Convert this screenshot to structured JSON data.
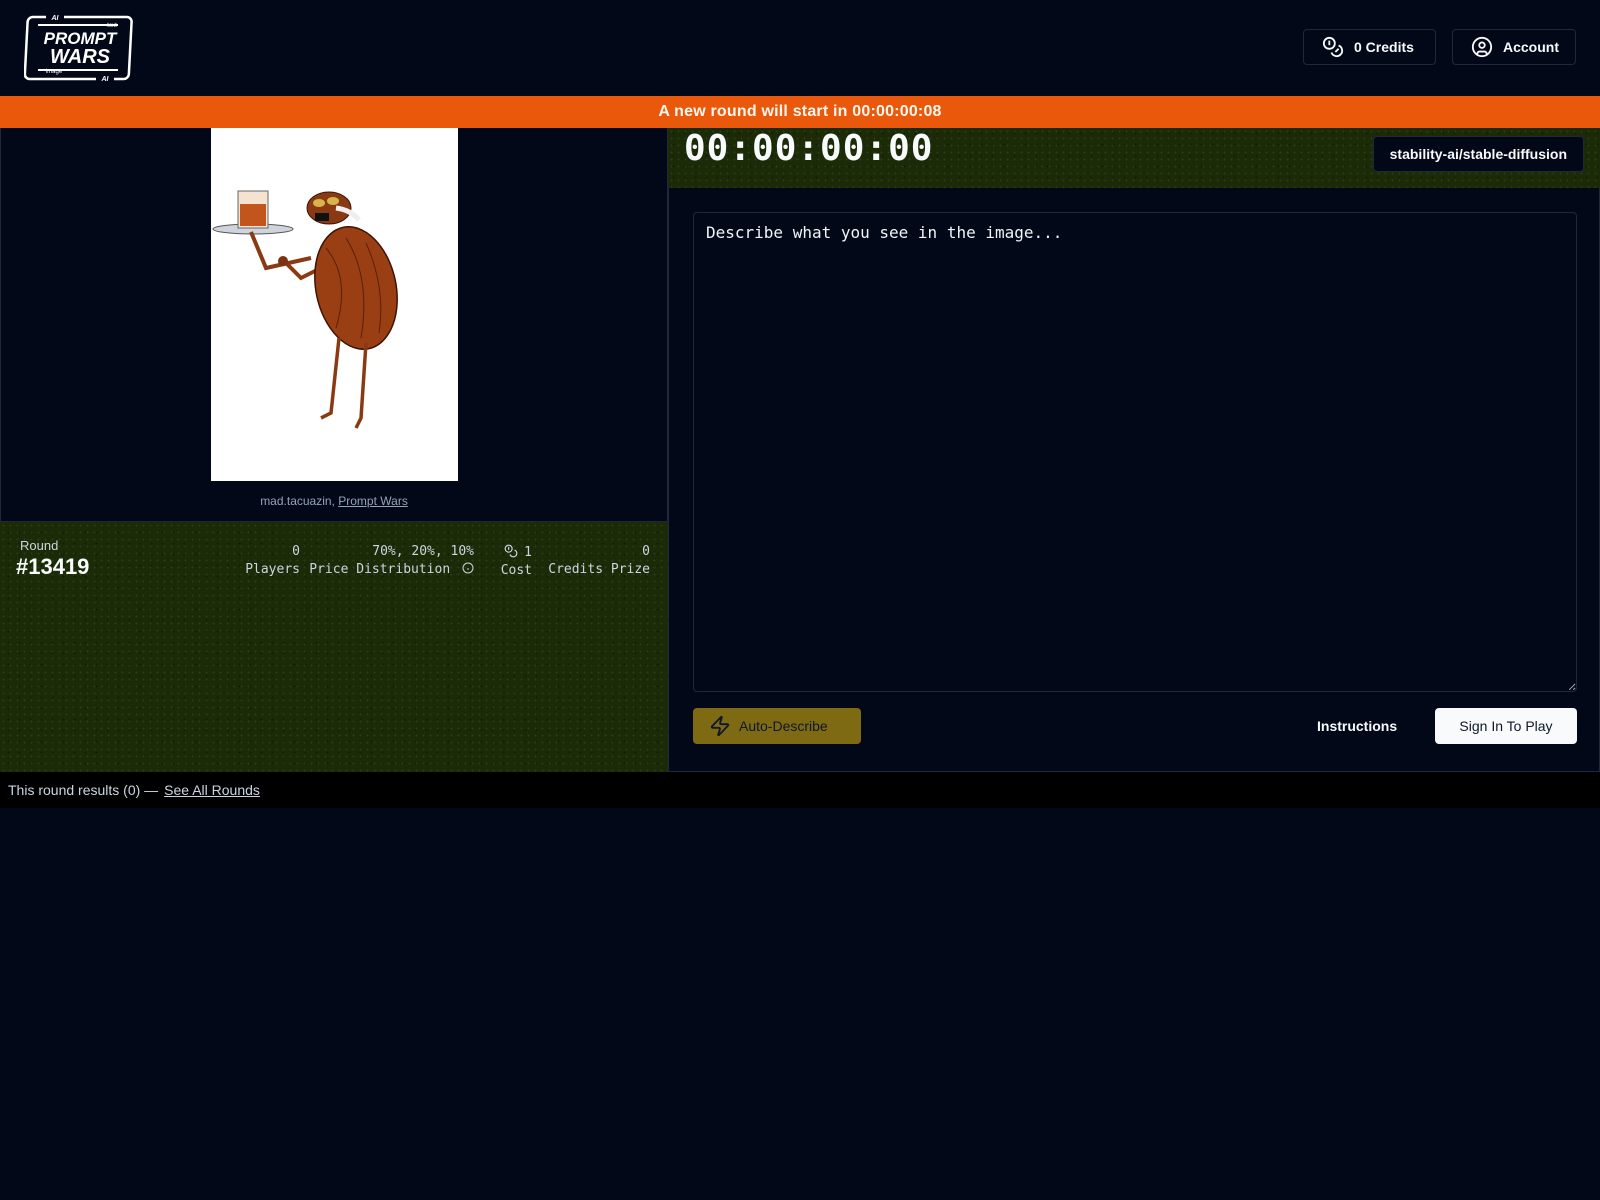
{
  "header": {
    "logo": {
      "top": "AI",
      "small_top": "text",
      "line1": "PROMPT",
      "line2": "WARS",
      "small_bottom": "image",
      "bottom": "AI"
    },
    "credits_label": "0 Credits",
    "account_label": "Account"
  },
  "banner": {
    "text": "A new round will start in 00:00:00:08"
  },
  "image_panel": {
    "image_alt": "Cartoon flea waiter holding a tray with a drink",
    "author": "mad.tacuazin,",
    "source_link": "Prompt Wars"
  },
  "round": {
    "label": "Round",
    "number": "#13419",
    "stats": [
      {
        "value": "0",
        "label": "Players"
      },
      {
        "value": "70%, 20%, 10%",
        "label": "Price Distribution"
      },
      {
        "value": "1",
        "label": "Cost",
        "icon": "coins-icon"
      },
      {
        "value": "0",
        "label": "Credits Prize"
      }
    ]
  },
  "game": {
    "timer": "00:00:00:00",
    "model": "stability-ai/stable-diffusion",
    "prompt_placeholder": "Describe what you see in the image...",
    "prompt_value": "",
    "auto_describe_label": "Auto-Describe",
    "instructions_label": "Instructions",
    "sign_in_label": "Sign In To Play"
  },
  "results": {
    "text": "This round results (0) —",
    "link": "See All Rounds"
  },
  "colors": {
    "background": "#020817",
    "banner": "#ea580c",
    "panel_green": "#1b2b08",
    "auto_describe": "#7d6a12",
    "primary_button": "#f8fafc"
  }
}
